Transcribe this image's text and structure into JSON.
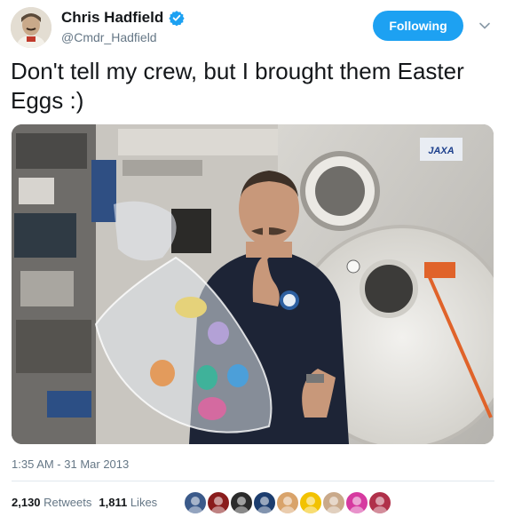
{
  "author": {
    "name": "Chris Hadfield",
    "handle": "@Cmdr_Hadfield",
    "verified": true
  },
  "follow_button": {
    "label": "Following"
  },
  "tweet": {
    "text": "Don't tell my crew, but I brought them Easter Eggs :)",
    "timestamp": "1:35 AM - 31 Mar 2013"
  },
  "stats": {
    "retweets_count": "2,130",
    "retweets_label": "Retweets",
    "likes_count": "1,811",
    "likes_label": "Likes"
  },
  "photo": {
    "sign_text": "JAXA"
  },
  "colors": {
    "accent": "#1da1f2",
    "text_primary": "#14171a",
    "text_secondary": "#657786",
    "divider": "#e1e8ed"
  },
  "likers": [
    {
      "icon": "liker-avatar-1",
      "color": "#3b5a8a"
    },
    {
      "icon": "liker-avatar-2",
      "color": "#8a1c1c"
    },
    {
      "icon": "liker-avatar-3",
      "color": "#2b2b2b"
    },
    {
      "icon": "liker-avatar-4",
      "color": "#1c3d6e"
    },
    {
      "icon": "liker-avatar-5",
      "color": "#d9a36a"
    },
    {
      "icon": "liker-avatar-6",
      "color": "#f2c200"
    },
    {
      "icon": "liker-avatar-7",
      "color": "#c9a98a"
    },
    {
      "icon": "liker-avatar-8",
      "color": "#d63aa0"
    },
    {
      "icon": "liker-avatar-9",
      "color": "#b0304a"
    }
  ]
}
